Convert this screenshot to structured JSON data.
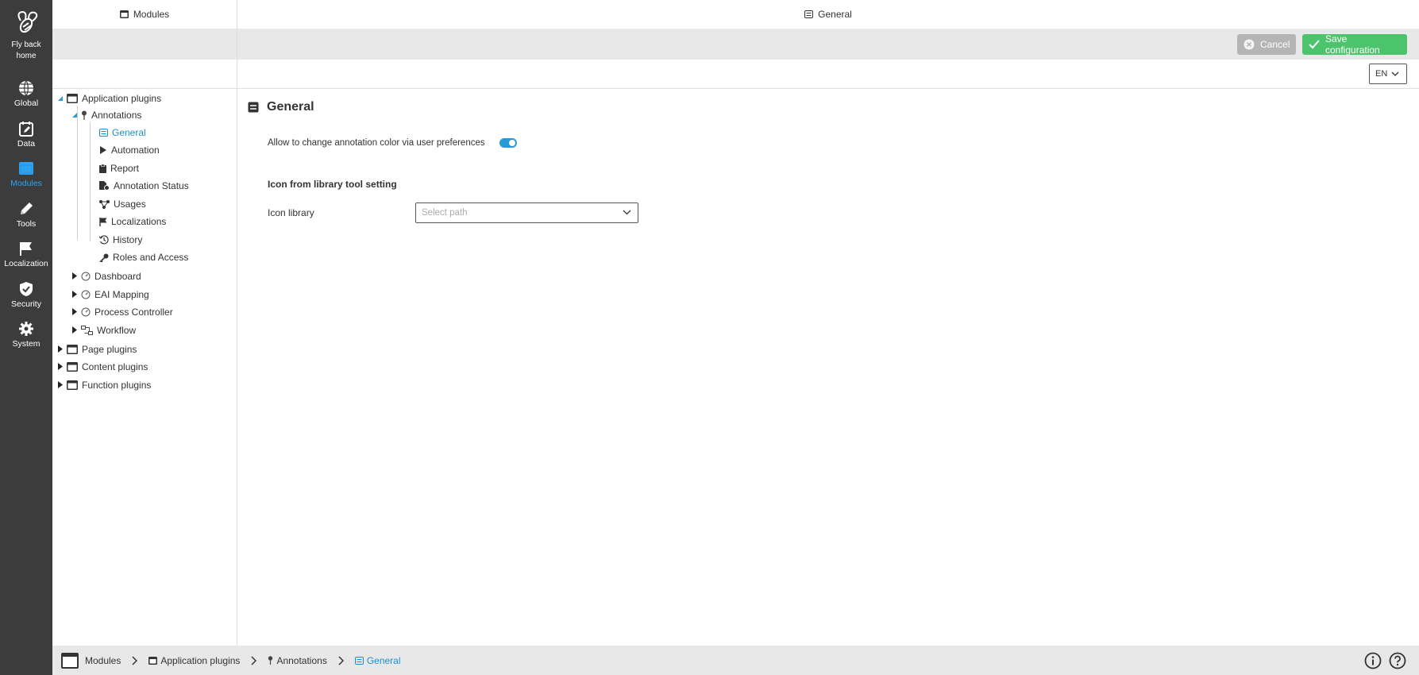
{
  "app": {
    "home_label_line1": "Fly back",
    "home_label_line2": "home"
  },
  "nav": {
    "items": [
      {
        "label": "Global",
        "icon": "globe-icon"
      },
      {
        "label": "Data",
        "icon": "calendar-edit-icon"
      },
      {
        "label": "Modules",
        "icon": "window-icon",
        "active": true
      },
      {
        "label": "Tools",
        "icon": "pencil-icon"
      },
      {
        "label": "Localization",
        "icon": "flag-icon"
      },
      {
        "label": "Security",
        "icon": "shield-check-icon"
      },
      {
        "label": "System",
        "icon": "gear-icon"
      }
    ]
  },
  "header": {
    "left_title": "Modules",
    "right_title": "General"
  },
  "actions": {
    "cancel_label": "Cancel",
    "save_label": "Save configuration"
  },
  "language": {
    "selected": "EN"
  },
  "tree": {
    "application_plugins": "Application plugins",
    "annotations": "Annotations",
    "children": [
      "General",
      "Automation",
      "Report",
      "Annotation Status",
      "Usages",
      "Localizations",
      "History",
      "Roles and Access"
    ],
    "siblings": [
      "Dashboard",
      "EAI Mapping",
      "Process Controller",
      "Workflow"
    ],
    "roots": [
      "Page plugins",
      "Content plugins",
      "Function plugins"
    ]
  },
  "main": {
    "title": "General",
    "toggle_label": "Allow to change annotation color via user preferences",
    "toggle_on": true,
    "section_title": "Icon from library tool setting",
    "icon_library_label": "Icon library",
    "icon_library_placeholder": "Select path"
  },
  "breadcrumb": [
    "Modules",
    "Application plugins",
    "Annotations",
    "General"
  ],
  "colors": {
    "sidebar": "#3c3c3c",
    "accent": "#2ea3f2",
    "save": "#4cc46c",
    "cancel": "#b5b5b5"
  }
}
